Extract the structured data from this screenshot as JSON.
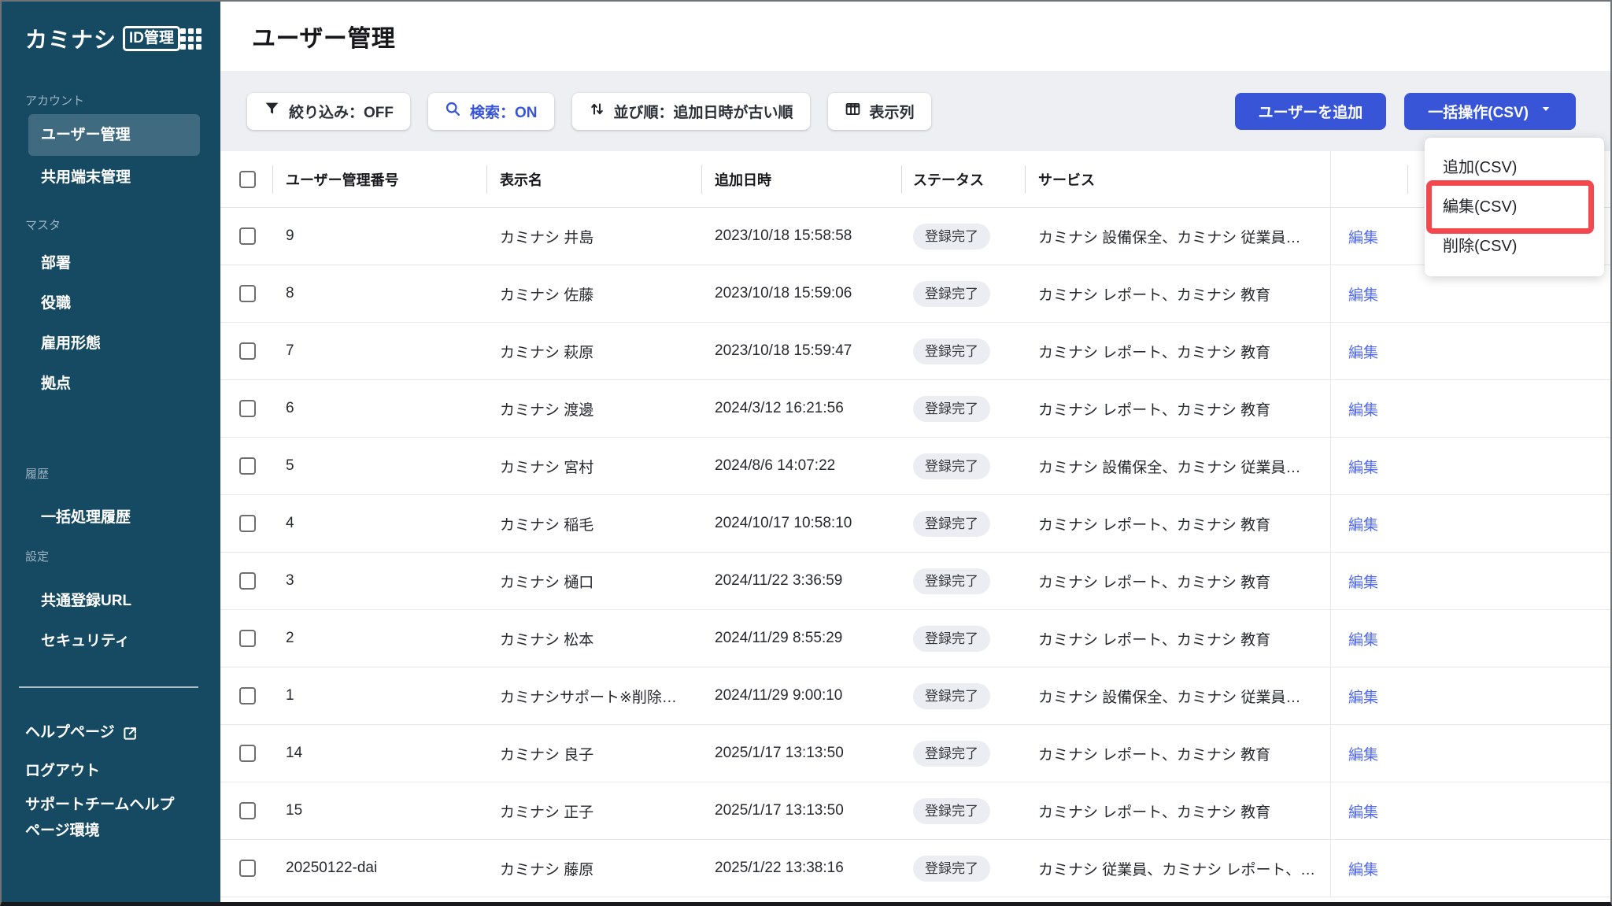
{
  "app": {
    "logo_text": "カミナシ",
    "logo_badge": "ID管理"
  },
  "header": {
    "title": "ユーザー管理"
  },
  "sidebar": {
    "sections": [
      {
        "label": "アカウント",
        "items": [
          {
            "label": "ユーザー管理",
            "active": true
          },
          {
            "label": "共用端末管理",
            "active": false
          }
        ]
      },
      {
        "label": "マスタ",
        "items": [
          {
            "label": "部署"
          },
          {
            "label": "役職"
          },
          {
            "label": "雇用形態"
          },
          {
            "label": "拠点"
          }
        ]
      },
      {
        "label": "履歴",
        "items": [
          {
            "label": "一括処理履歴"
          }
        ]
      },
      {
        "label": "設定",
        "items": [
          {
            "label": "共通登録URL"
          },
          {
            "label": "セキュリティ"
          }
        ]
      }
    ],
    "footer": {
      "help": "ヘルプページ",
      "logout": "ログアウト",
      "support": "サポートチームヘルプページ環境"
    }
  },
  "toolbar": {
    "filter_label": "絞り込み：OFF",
    "search_label": "検索：ON",
    "sort_label": "並び順：追加日時が古い順",
    "columns_label": "表示列",
    "add_user_label": "ユーザーを追加",
    "bulk_label": "一括操作(CSV)"
  },
  "dropdown": {
    "items": [
      "追加(CSV)",
      "編集(CSV)",
      "削除(CSV)"
    ],
    "highlighted_item": "編集(CSV)"
  },
  "table": {
    "headers": [
      "ユーザー管理番号",
      "表示名",
      "追加日時",
      "ステータス",
      "サービス"
    ],
    "edit_label": "編集",
    "rows": [
      {
        "id": "9",
        "name": "カミナシ 井島",
        "added_at": "2023/10/18 15:58:58",
        "status": "登録完了",
        "services": "カミナシ 設備保全、カミナシ 従業員…"
      },
      {
        "id": "8",
        "name": "カミナシ 佐藤",
        "added_at": "2023/10/18 15:59:06",
        "status": "登録完了",
        "services": "カミナシ レポート、カミナシ 教育"
      },
      {
        "id": "7",
        "name": "カミナシ 萩原",
        "added_at": "2023/10/18 15:59:47",
        "status": "登録完了",
        "services": "カミナシ レポート、カミナシ 教育"
      },
      {
        "id": "6",
        "name": "カミナシ 渡邊",
        "added_at": "2024/3/12 16:21:56",
        "status": "登録完了",
        "services": "カミナシ レポート、カミナシ 教育"
      },
      {
        "id": "5",
        "name": "カミナシ 宮村",
        "added_at": "2024/8/6 14:07:22",
        "status": "登録完了",
        "services": "カミナシ 設備保全、カミナシ 従業員…"
      },
      {
        "id": "4",
        "name": "カミナシ 稲毛",
        "added_at": "2024/10/17 10:58:10",
        "status": "登録完了",
        "services": "カミナシ レポート、カミナシ 教育"
      },
      {
        "id": "3",
        "name": "カミナシ 樋口",
        "added_at": "2024/11/22 3:36:59",
        "status": "登録完了",
        "services": "カミナシ レポート、カミナシ 教育"
      },
      {
        "id": "2",
        "name": "カミナシ 松本",
        "added_at": "2024/11/29 8:55:29",
        "status": "登録完了",
        "services": "カミナシ レポート、カミナシ 教育"
      },
      {
        "id": "1",
        "name": "カミナシサポート※削除…",
        "added_at": "2024/11/29 9:00:10",
        "status": "登録完了",
        "services": "カミナシ 設備保全、カミナシ 従業員…"
      },
      {
        "id": "14",
        "name": "カミナシ 良子",
        "added_at": "2025/1/17 13:13:50",
        "status": "登録完了",
        "services": "カミナシ レポート、カミナシ 教育"
      },
      {
        "id": "15",
        "name": "カミナシ 正子",
        "added_at": "2025/1/17 13:13:50",
        "status": "登録完了",
        "services": "カミナシ レポート、カミナシ 教育"
      },
      {
        "id": "20250122-dai",
        "name": "カミナシ 藤原",
        "added_at": "2025/1/22 13:38:16",
        "status": "登録完了",
        "services": "カミナシ 従業員、カミナシ レポート、…"
      }
    ]
  },
  "colors": {
    "sidebar-bg": "#164A63",
    "accent-blue": "#3755D6",
    "link-blue": "#5069F2",
    "annotation-red": "#F4484F",
    "pill-bg": "#EBEDF2",
    "band-gray": "#EDEFF3"
  }
}
